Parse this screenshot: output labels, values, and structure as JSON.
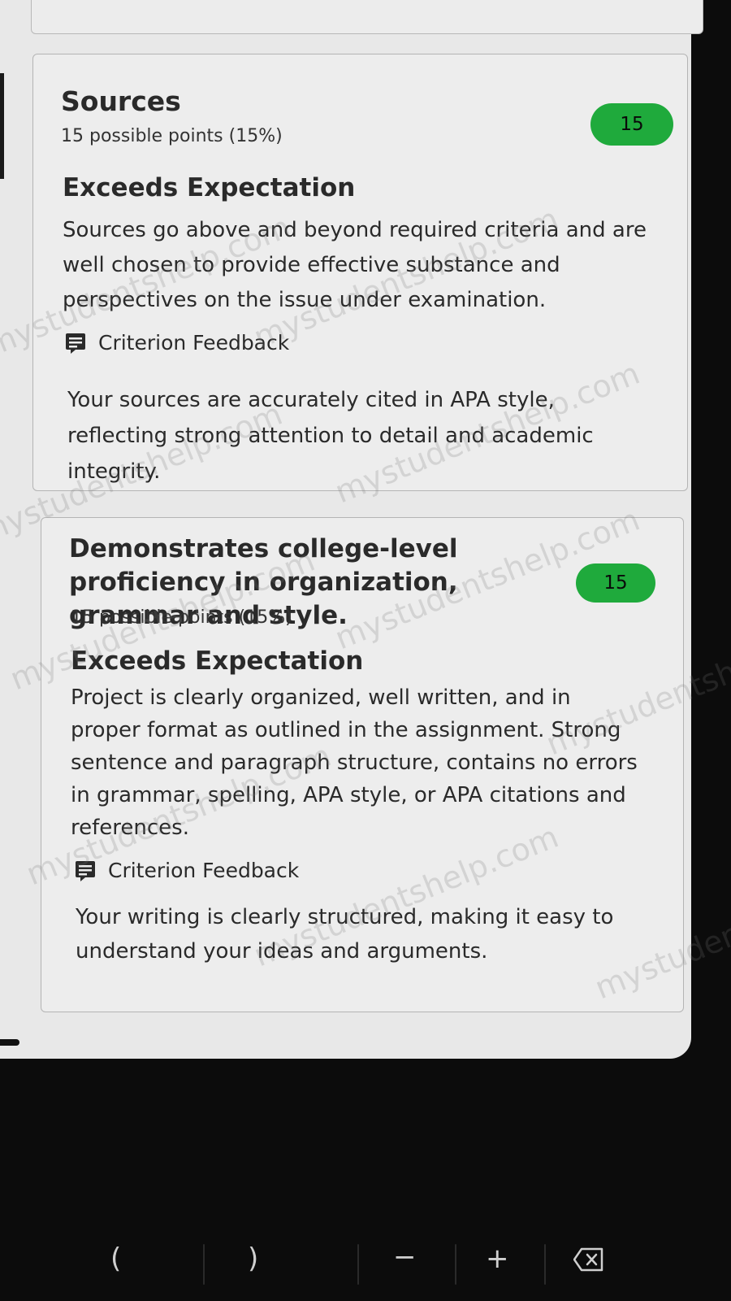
{
  "criteria": [
    {
      "title": "Sources",
      "points": "15 possible points (15%)",
      "score": "15",
      "rating": "Exceeds Expectation",
      "description": "Sources go above and beyond required criteria and are well chosen to provide effective substance and perspectives on the issue under examination.",
      "feedback_label": "Criterion Feedback",
      "feedback": "Your sources are accurately cited in APA style, reflecting strong attention to detail and academic integrity."
    },
    {
      "title": "Demonstrates college-level proficiency in organization, grammar and style.",
      "points": "15 possible points (15%)",
      "score": "15",
      "rating": "Exceeds Expectation",
      "description": "Project is clearly organized, well written, and in proper format as outlined in the assignment. Strong sentence and paragraph structure, contains no errors in grammar, spelling, APA style, or APA citations and references.",
      "feedback_label": "Criterion Feedback",
      "feedback": "Your writing is clearly structured, making it easy to understand your ideas and arguments."
    }
  ],
  "watermark": "mystudentshelp.com",
  "keyboard": {
    "keys": [
      "(",
      ")",
      "−",
      "+"
    ],
    "delete_icon": "backspace-icon"
  },
  "colors": {
    "badge": "#1faa3c",
    "screen_bg": "#e8e8e8"
  }
}
